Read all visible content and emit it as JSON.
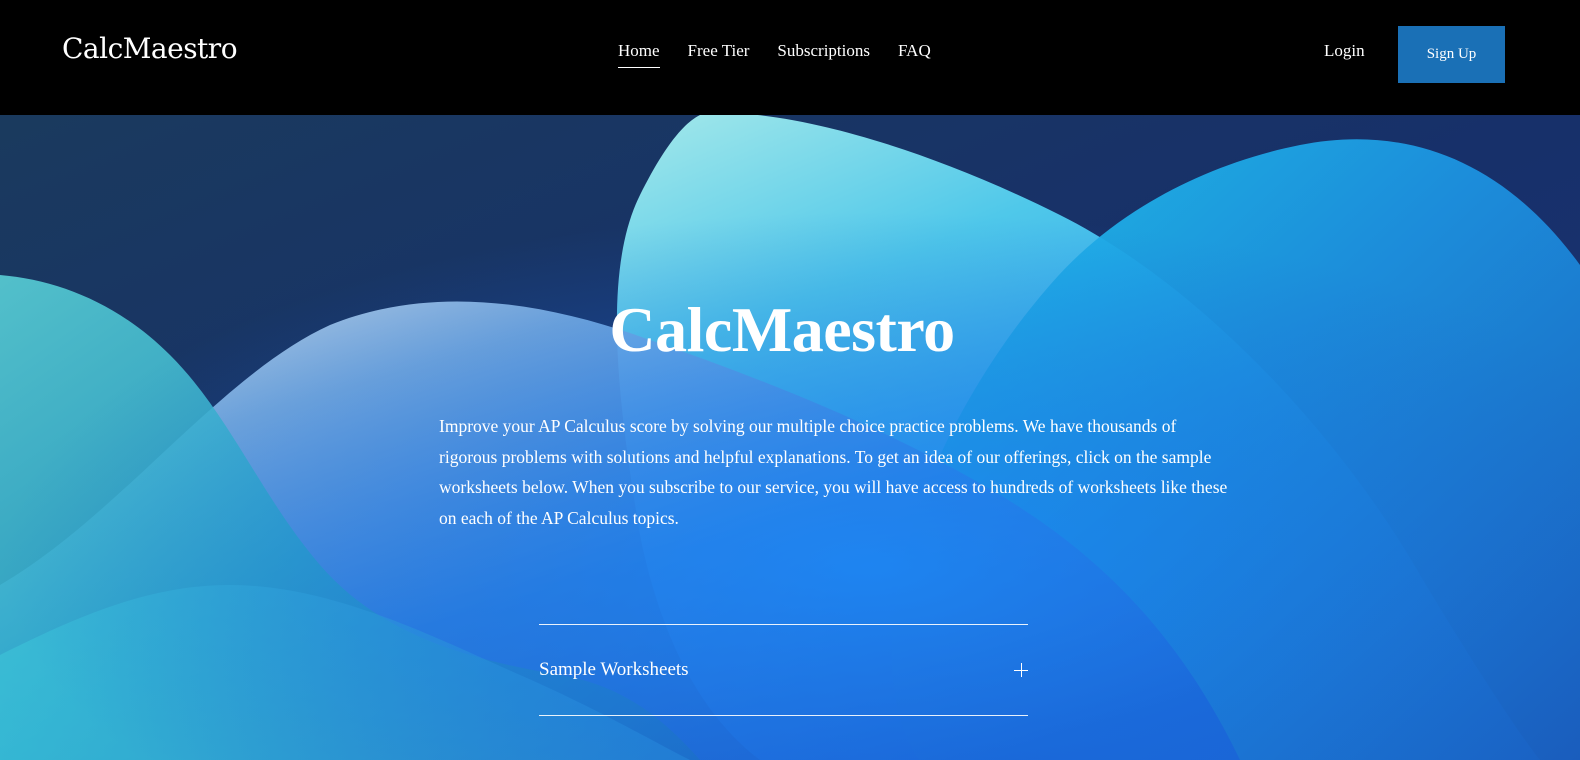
{
  "header": {
    "logo": "CalcMaestro",
    "nav": [
      {
        "label": "Home",
        "active": true
      },
      {
        "label": "Free Tier",
        "active": false
      },
      {
        "label": "Subscriptions",
        "active": false
      },
      {
        "label": "FAQ",
        "active": false
      }
    ],
    "login_label": "Login",
    "signup_label": "Sign Up"
  },
  "hero": {
    "title": "CalcMaestro",
    "description": "Improve your AP Calculus score by solving our multiple choice practice problems. We have thousands of rigorous problems with solutions and helpful explanations. To get an idea of our offerings, click on the sample worksheets below. When you subscribe to our service, you will have access to hundreds of worksheets like these on each of the AP Calculus topics.",
    "accordion_label": "Sample Worksheets",
    "accordion_icon": "plus-icon"
  },
  "colors": {
    "header_bg": "#000000",
    "signup_bg": "#1a70b6",
    "hero_dark": "#15305f",
    "hero_bright": "#1a7ef0",
    "hero_cyan": "#38d4e0"
  }
}
